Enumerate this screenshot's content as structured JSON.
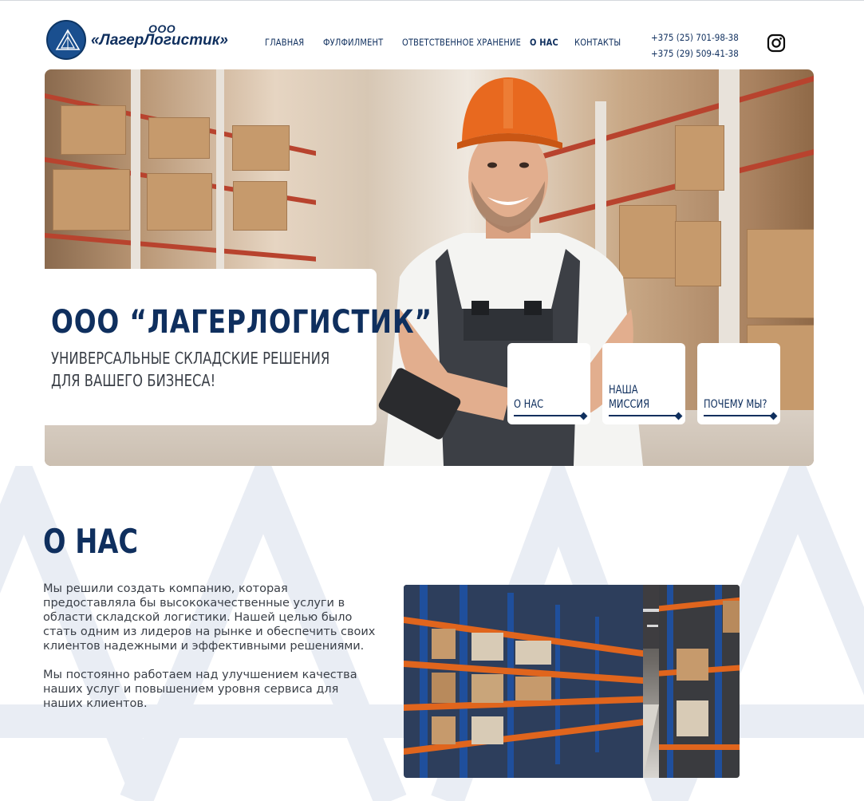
{
  "header": {
    "logo_ooo": "ООО",
    "logo_name": "«ЛагерЛогистик»",
    "nav": [
      {
        "label": "ГЛАВНАЯ",
        "active": false
      },
      {
        "label": "ФУЛФИЛМЕНТ",
        "active": false
      },
      {
        "label": "ОТВЕТСТВЕННОЕ ХРАНЕНИЕ",
        "active": false
      },
      {
        "label": "О НАС",
        "active": true
      },
      {
        "label": "КОНТАКТЫ",
        "active": false
      }
    ],
    "phones": [
      "+375 (25) 701-98-38",
      "+375 (29) 509-41-38"
    ],
    "social_icon": "instagram-icon"
  },
  "hero": {
    "title": "ООО “ЛАГЕРЛОГИСТИК”",
    "subtitle_line1": "УНИВЕРСАЛЬНЫЕ СКЛАДСКИЕ РЕШЕНИЯ",
    "subtitle_line2": "ДЛЯ ВАШЕГО БИЗНЕСА!",
    "links": [
      {
        "line1": "",
        "line2": "О НАС"
      },
      {
        "line1": "НАША",
        "line2": "МИССИЯ"
      },
      {
        "line1": "",
        "line2": "ПОЧЕМУ МЫ?"
      }
    ]
  },
  "about": {
    "title": "О НАС",
    "paragraph1": "Мы решили создать компанию, которая предоставляла бы высококачественные услуги в области складской логистики. Нашей целью было стать одним из лидеров на рынке и обеспечить своих клиентов надежными и эффективными решениями.",
    "paragraph2": "Мы постоянно работаем над улучшением качества наших услуг и повышением уровня сервиса для наших клиентов."
  },
  "colors": {
    "brand_navy": "#0f2f5e",
    "hard_hat": "#e8691f",
    "shelf_red": "#b8432e",
    "rack_blue": "#1f4f9c",
    "rack_orange": "#e0651d"
  }
}
